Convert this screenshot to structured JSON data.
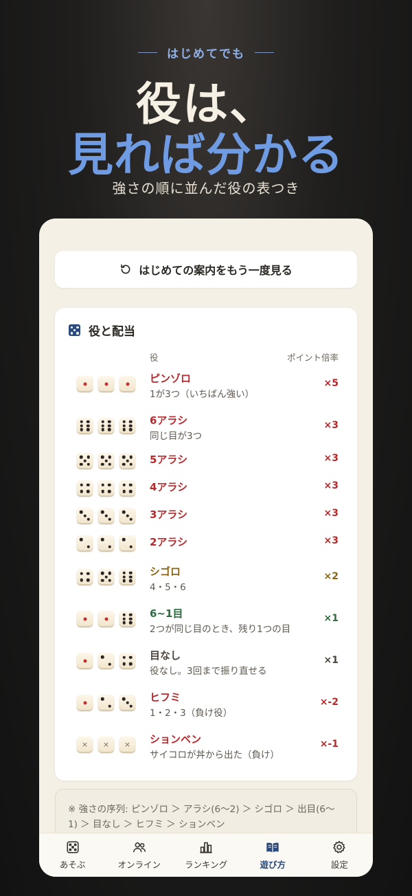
{
  "hero": {
    "eyebrow": "はじめてでも",
    "title_line1": "役は、",
    "title_line2": "見れば分かる",
    "subtitle": "強さの順に並んだ役の表つき"
  },
  "replay_button": {
    "label": "はじめての案内をもう一度見る",
    "icon": "replay-icon"
  },
  "payout_card": {
    "title": "役と配当",
    "icon": "dice-icon",
    "col_role": "役",
    "col_multiplier": "ポイント倍率",
    "rows": [
      {
        "name": "ピンゾロ",
        "desc": "1が3つ（いちばん強い）",
        "multiplier": "×5",
        "dice": [
          1,
          1,
          1
        ],
        "color": "#b8282c"
      },
      {
        "name": "6アラシ",
        "desc": "同じ目が3つ",
        "multiplier": "×3",
        "dice": [
          6,
          6,
          6
        ],
        "color": "#b8282c"
      },
      {
        "name": "5アラシ",
        "desc": "",
        "multiplier": "×3",
        "dice": [
          5,
          5,
          5
        ],
        "color": "#b8282c"
      },
      {
        "name": "4アラシ",
        "desc": "",
        "multiplier": "×3",
        "dice": [
          4,
          4,
          4
        ],
        "color": "#b8282c"
      },
      {
        "name": "3アラシ",
        "desc": "",
        "multiplier": "×3",
        "dice": [
          3,
          3,
          3
        ],
        "color": "#b8282c"
      },
      {
        "name": "2アラシ",
        "desc": "",
        "multiplier": "×3",
        "dice": [
          2,
          2,
          2
        ],
        "color": "#b8282c"
      },
      {
        "name": "シゴロ",
        "desc": "4・5・6",
        "multiplier": "×2",
        "dice": [
          4,
          5,
          6
        ],
        "color": "#8a6412"
      },
      {
        "name": "6~1目",
        "desc": "2つが同じ目のとき、残り1つの目",
        "multiplier": "×1",
        "dice": [
          1,
          1,
          6
        ],
        "color": "#2b6b3e"
      },
      {
        "name": "目なし",
        "desc": "役なし。3回まで振り直せる",
        "multiplier": "×1",
        "dice": [
          1,
          2,
          4
        ],
        "color": "#4a443c"
      },
      {
        "name": "ヒフミ",
        "desc": "1・2・3（負け役）",
        "multiplier": "×-2",
        "dice": [
          1,
          2,
          3
        ],
        "color": "#b8282c"
      },
      {
        "name": "ションベン",
        "desc": "サイコロが丼から出た（負け）",
        "multiplier": "×-1",
        "dice": [
          "x",
          "x",
          "x"
        ],
        "color": "#b8282c"
      }
    ]
  },
  "order_note": "※ 強さの序列: ピンゾロ ＞ アラシ(6〜2) ＞ シゴロ ＞ 出目(6〜1) ＞ 目なし ＞ ヒフミ ＞ ションベン",
  "tabs": [
    {
      "label": "あそぶ",
      "icon": "dice-icon",
      "active": false
    },
    {
      "label": "オンライン",
      "icon": "users-icon",
      "active": false
    },
    {
      "label": "ランキング",
      "icon": "bar-chart-icon",
      "active": false
    },
    {
      "label": "遊び方",
      "icon": "book-icon",
      "active": true
    },
    {
      "label": "設定",
      "icon": "gear-icon",
      "active": false
    }
  ]
}
